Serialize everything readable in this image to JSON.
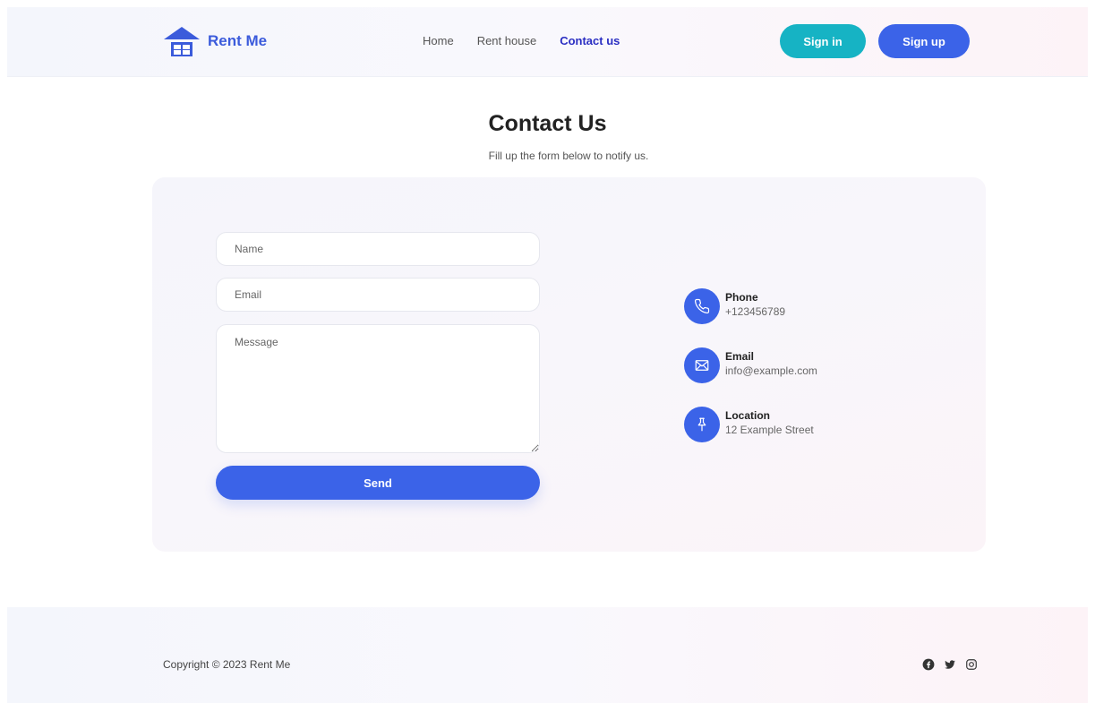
{
  "header": {
    "brand": "Rent Me",
    "nav": [
      {
        "label": "Home",
        "active": false
      },
      {
        "label": "Rent house",
        "active": false
      },
      {
        "label": "Contact us",
        "active": true
      }
    ],
    "signin_label": "Sign in",
    "signup_label": "Sign up"
  },
  "page": {
    "title": "Contact Us",
    "subtitle": "Fill up the form below to notify us."
  },
  "form": {
    "name_placeholder": "Name",
    "email_placeholder": "Email",
    "message_placeholder": "Message",
    "send_label": "Send"
  },
  "contact": [
    {
      "label": "Phone",
      "value": "+123456789",
      "icon": "phone-icon"
    },
    {
      "label": "Email",
      "value": "info@example.com",
      "icon": "envelope-icon"
    },
    {
      "label": "Location",
      "value": "12 Example Street",
      "icon": "pushpin-icon"
    }
  ],
  "footer": {
    "copyright": "Copyright © 2023 Rent Me",
    "social": [
      "facebook-icon",
      "twitter-icon",
      "instagram-icon"
    ]
  },
  "colors": {
    "primary": "#3b63e8",
    "signin": "#16b3c4",
    "nav_active": "#2a2ec2",
    "brand": "#3b5bdb"
  }
}
